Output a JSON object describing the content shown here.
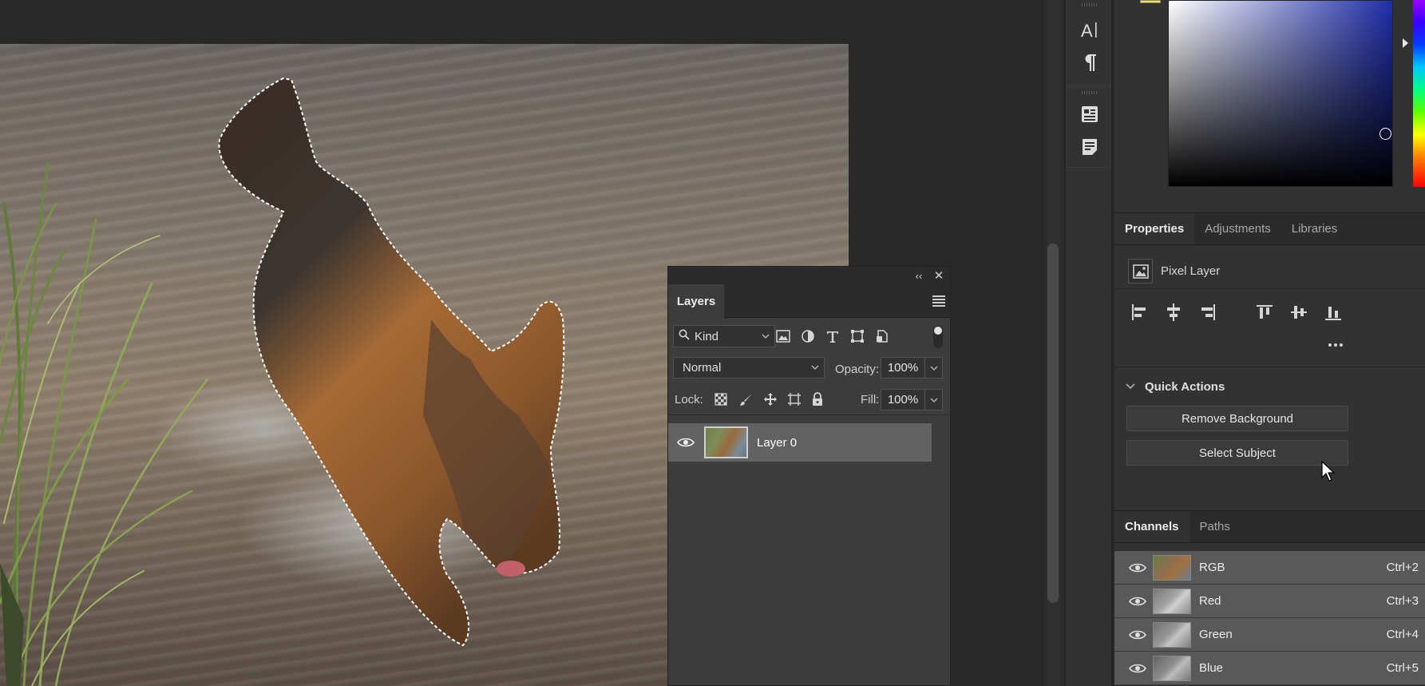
{
  "toolDock": {
    "icons": [
      "character-icon",
      "paragraph-icon",
      "character-styles-icon",
      "notes-icon"
    ]
  },
  "properties": {
    "tabs": [
      "Properties",
      "Adjustments",
      "Libraries"
    ],
    "layer_type": "Pixel Layer",
    "quick_actions_title": "Quick Actions",
    "remove_background_label": "Remove Background",
    "select_subject_label": "Select Subject"
  },
  "channelsPanel": {
    "tabs": [
      "Channels",
      "Paths"
    ],
    "channels": [
      {
        "name": "RGB",
        "shortcut": "Ctrl+2"
      },
      {
        "name": "Red",
        "shortcut": "Ctrl+3"
      },
      {
        "name": "Green",
        "shortcut": "Ctrl+4"
      },
      {
        "name": "Blue",
        "shortcut": "Ctrl+5"
      }
    ]
  },
  "layersPanel": {
    "collapse_glyph": "‹‹",
    "close_glyph": "✕",
    "title": "Layers",
    "kind_label": "Kind",
    "blend_mode": "Normal",
    "opacity_label": "Opacity:",
    "opacity_value": "100%",
    "lock_label": "Lock:",
    "fill_label": "Fill:",
    "fill_value": "100%",
    "layers": [
      {
        "name": "Layer 0",
        "visible": true
      }
    ]
  },
  "colors": {
    "panel_bg": "#323232",
    "tab_bar_bg": "#2b2b2b",
    "selected_row": "#595959",
    "color_field_hue": "#1f2ea8"
  }
}
